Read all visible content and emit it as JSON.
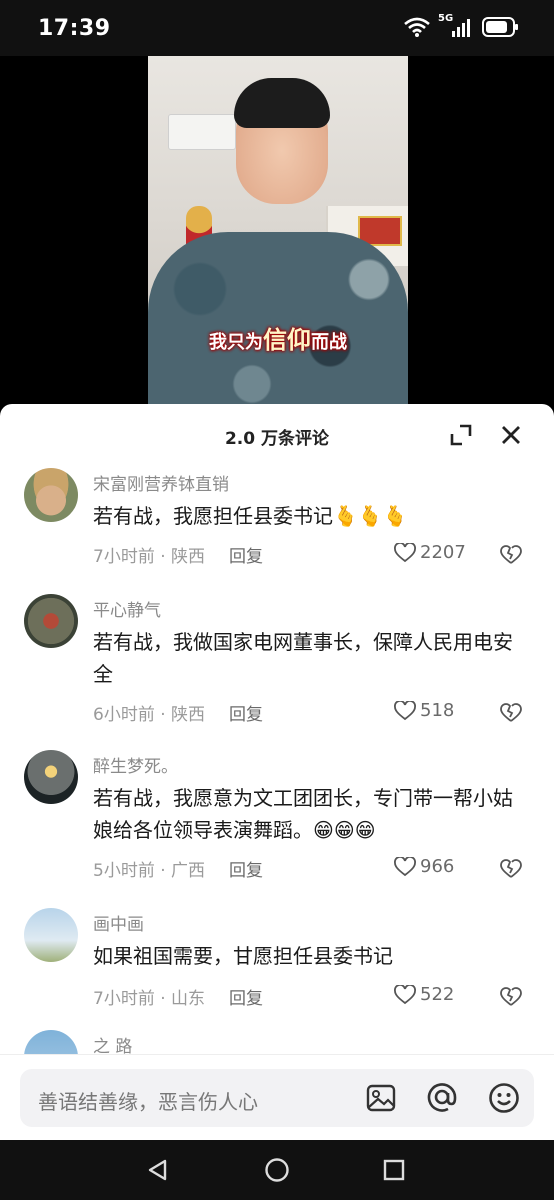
{
  "status_bar": {
    "time": "17:39",
    "network": "5G"
  },
  "video": {
    "subtitle_small_1": "我只为",
    "subtitle_big": "信仰",
    "subtitle_small_2": "而战"
  },
  "comments_panel": {
    "title": "2.0 万条评论",
    "icons": {
      "expand": "expand-icon",
      "close": "close-icon"
    }
  },
  "comments": [
    {
      "username": "宋富刚营养钵直销",
      "text": "若有战，我愿担任县委书记🫰🫰🫰",
      "time": "7小时前",
      "location": "陕西",
      "reply_label": "回复",
      "likes": "2207"
    },
    {
      "username": "平心静气",
      "text": "若有战，我做国家电网董事长，保障人民用电安全",
      "time": "6小时前",
      "location": "陕西",
      "reply_label": "回复",
      "likes": "518"
    },
    {
      "username": "醉生梦死。",
      "text": "若有战，我愿意为文工团团长，专门带一帮小姑娘给各位领导表演舞蹈。😁😁😁",
      "time": "5小时前",
      "location": "广西",
      "reply_label": "回复",
      "likes": "966"
    },
    {
      "username": "画中画",
      "text": "如果祖国需要，甘愿担任县委书记",
      "time": "7小时前",
      "location": "山东",
      "reply_label": "回复",
      "likes": "522"
    },
    {
      "username": "之 路"
    }
  ],
  "input_bar": {
    "placeholder": "善语结善缘，恶言伤人心",
    "icons": [
      "image-icon",
      "at-icon",
      "emoji-icon"
    ]
  },
  "nav_bar": {
    "icons": [
      "back-icon",
      "home-icon",
      "recent-apps-icon"
    ]
  }
}
